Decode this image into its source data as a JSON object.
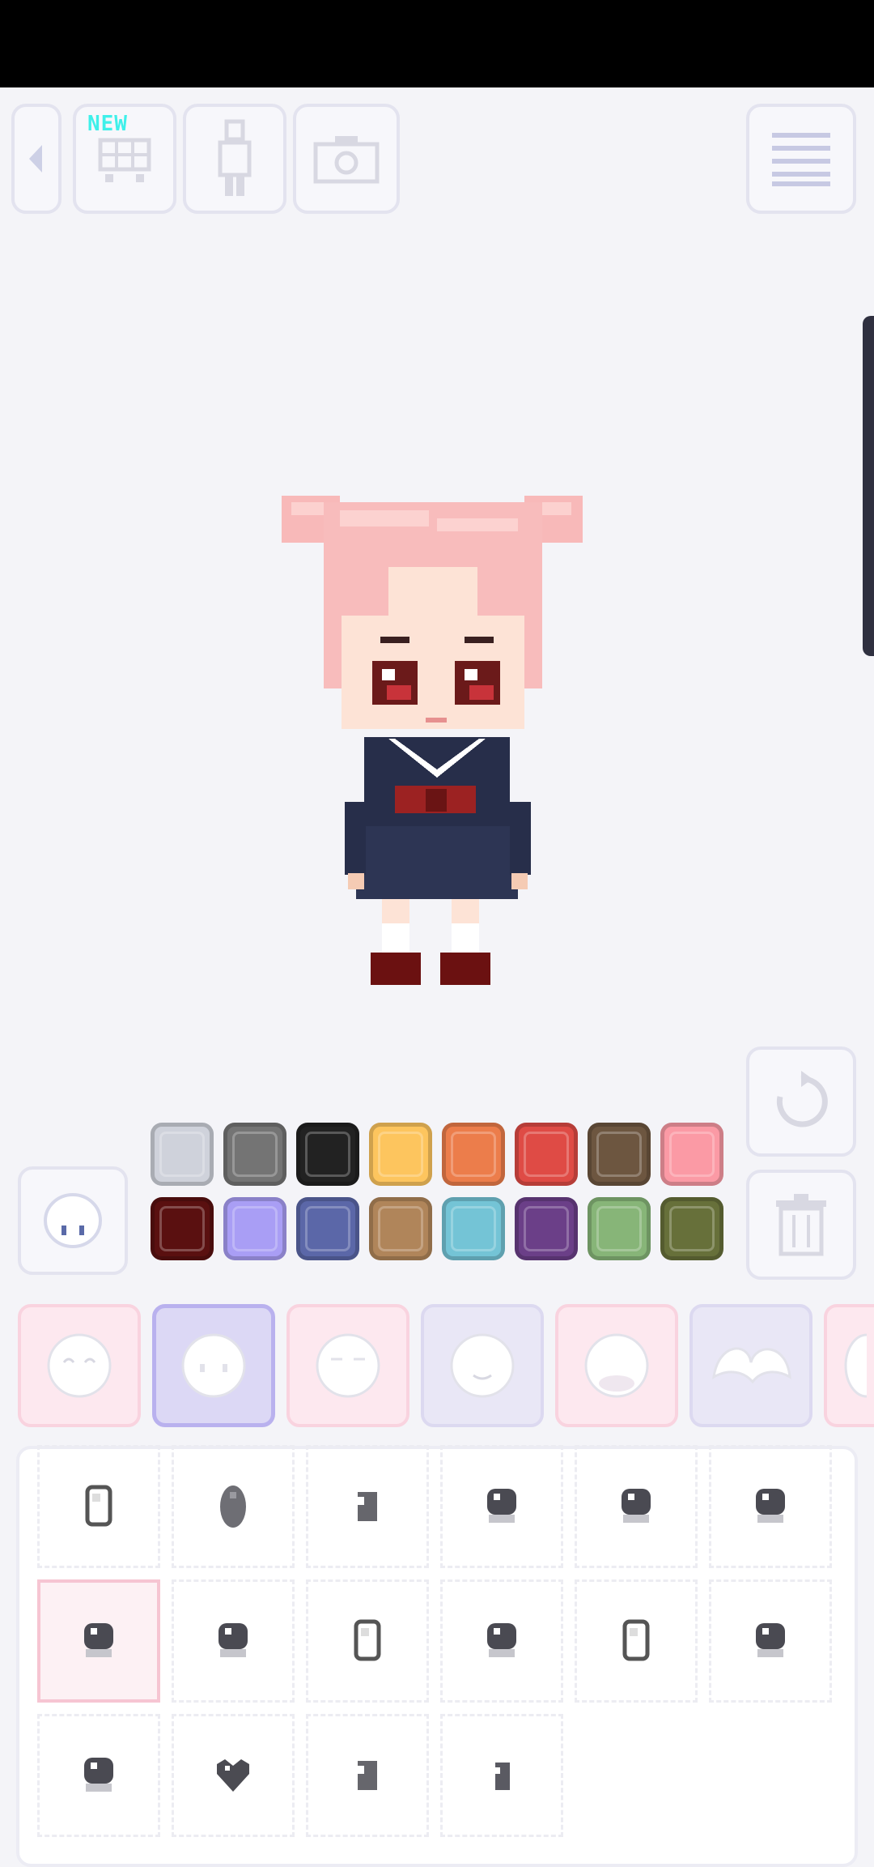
{
  "toolbar": {
    "back": "back-icon",
    "shop": {
      "icon": "cart-icon",
      "badge": "NEW"
    },
    "body": "body-icon",
    "camera": "camera-icon",
    "menu": "menu-icon"
  },
  "colors": {
    "row1": [
      "#cfd2db",
      "#747474",
      "#222222",
      "#fdc55e",
      "#ec7d4b",
      "#df4b45",
      "#6d5640",
      "#fb9aa5"
    ],
    "row2": [
      "#5a1010",
      "#a99ef5",
      "#5b67a8",
      "#b0855a",
      "#74c4d6",
      "#6b3f88",
      "#87b578",
      "#67703a"
    ]
  },
  "actions": {
    "reset": "reset-icon",
    "trash": "trash-icon",
    "face": "face-preview-icon"
  },
  "tabs": [
    {
      "icon": "face-smile-eyes-icon",
      "style": "pink"
    },
    {
      "icon": "face-eyes-icon",
      "style": "sel"
    },
    {
      "icon": "face-brows-icon",
      "style": "pink"
    },
    {
      "icon": "face-mouth-icon",
      "style": "lav"
    },
    {
      "icon": "face-blush-icon",
      "style": "pink"
    },
    {
      "icon": "hair-icon",
      "style": "lav"
    },
    {
      "icon": "more-icon",
      "style": "pink"
    }
  ],
  "eye_items": [
    "eye-style-1-icon",
    "eye-style-2-icon",
    "eye-style-3-icon",
    "eye-style-4-icon",
    "eye-style-5-icon",
    "eye-style-6-icon",
    "eye-style-7-icon",
    "eye-style-8-icon",
    "eye-style-9-icon",
    "eye-style-10-icon",
    "eye-style-11-icon",
    "eye-style-12-icon",
    "eye-style-13-icon",
    "eye-style-14-icon",
    "eye-style-15-icon",
    "eye-style-16-icon"
  ],
  "selected_eye": 6
}
